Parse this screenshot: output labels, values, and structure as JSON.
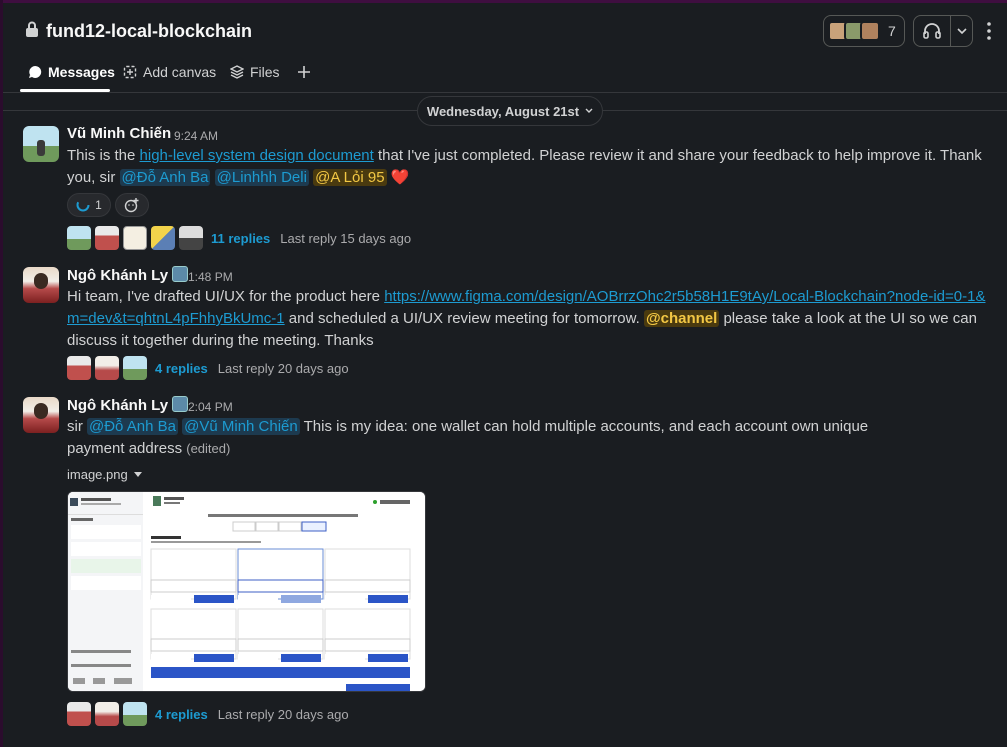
{
  "channel": {
    "name": "fund12-local-blockchain",
    "member_count": "7"
  },
  "tabs": [
    {
      "label": "Messages"
    },
    {
      "label": "Add canvas"
    },
    {
      "label": "Files"
    }
  ],
  "date_divider": "Wednesday, August 21st",
  "messages": [
    {
      "author": "Vũ Minh Chiến",
      "time": "9:24 AM",
      "text_1": "This is the ",
      "link": "high-level system design document",
      "text_2": " that I've just completed. Please review it and share your feedback to help improve it. Thank you, sir ",
      "mention_1": "@Đỗ Anh Ba",
      "mention_2": "@Linhhh Deli",
      "mention_3": "@A Lỏi 95",
      "emoji": "❤️",
      "reaction_count": "1",
      "replies": "11 replies",
      "last_reply": "Last reply 15 days ago"
    },
    {
      "author": "Ngô Khánh Ly",
      "time": "1:48 PM",
      "text_1": "Hi team, I've drafted UI/UX for the product here ",
      "link": "https://www.figma.com/design/AOBrrzOhc2r5b58H1E9tAy/Local-Blockchain?node-id=0-1&m=dev&t=qhtnL4pFhhyBkUmc-1",
      "text_2": " and scheduled a UI/UX review meeting for tomorrow. ",
      "mention_1": "@channel",
      "text_3": " please take a look at the UI so we can discuss it together during the meeting. Thanks",
      "replies": "4 replies",
      "last_reply": "Last reply 20 days ago"
    },
    {
      "author": "Ngô Khánh Ly",
      "time": "2:04 PM",
      "text_1": "sir ",
      "mention_1": "@Đỗ Anh Ba",
      "mention_2": "@Vũ Minh Chiến",
      "text_2": " This is my idea: one wallet can hold multiple accounts, and each account own unique payment address ",
      "edited": "(edited)",
      "file_name": "image.png",
      "replies": "4 replies",
      "last_reply": "Last reply 20 days ago"
    }
  ],
  "colors": {
    "background": "#1a1d21",
    "link": "#1d9bd1",
    "mention_bg": "#1d3a4f",
    "channel_mention": "#f2c744"
  }
}
